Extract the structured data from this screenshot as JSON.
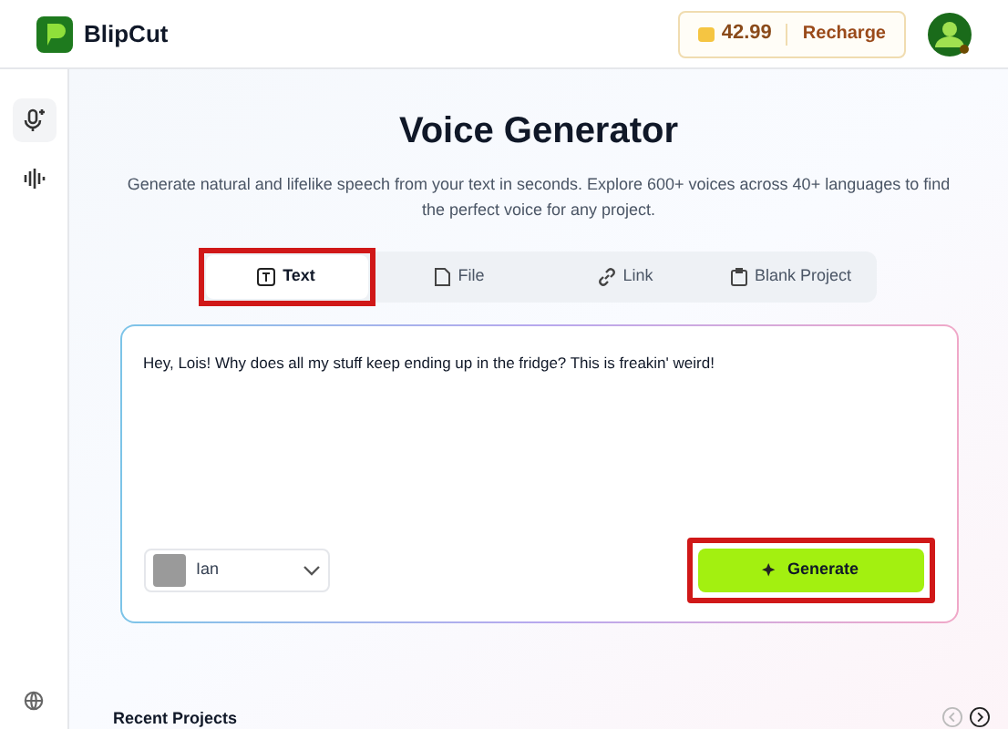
{
  "header": {
    "brand": "BlipCut",
    "credits": "42.99",
    "recharge": "Recharge"
  },
  "sidebar": {
    "items": [
      {
        "kind": "voice",
        "selected": true
      },
      {
        "kind": "wave",
        "selected": false
      }
    ]
  },
  "title": "Voice Generator",
  "description": "Generate natural and lifelike speech from your text in seconds. Explore 600+ voices across 40+ languages to find the perfect voice for any project.",
  "tabs": [
    {
      "kind": "text",
      "label": "Text",
      "selected": true,
      "highlighted": true
    },
    {
      "kind": "file",
      "label": "File",
      "selected": false,
      "highlighted": false
    },
    {
      "kind": "link",
      "label": "Link",
      "selected": false,
      "highlighted": false
    },
    {
      "kind": "blank",
      "label": "Blank Project",
      "selected": false,
      "highlighted": false
    }
  ],
  "editor": {
    "value": "Hey, Lois! Why does all my stuff keep ending up in the fridge? This is freakin' weird!"
  },
  "voice": {
    "name": "Ian"
  },
  "generate": {
    "label": "Generate",
    "highlighted": true
  },
  "recent": {
    "title": "Recent Projects"
  }
}
